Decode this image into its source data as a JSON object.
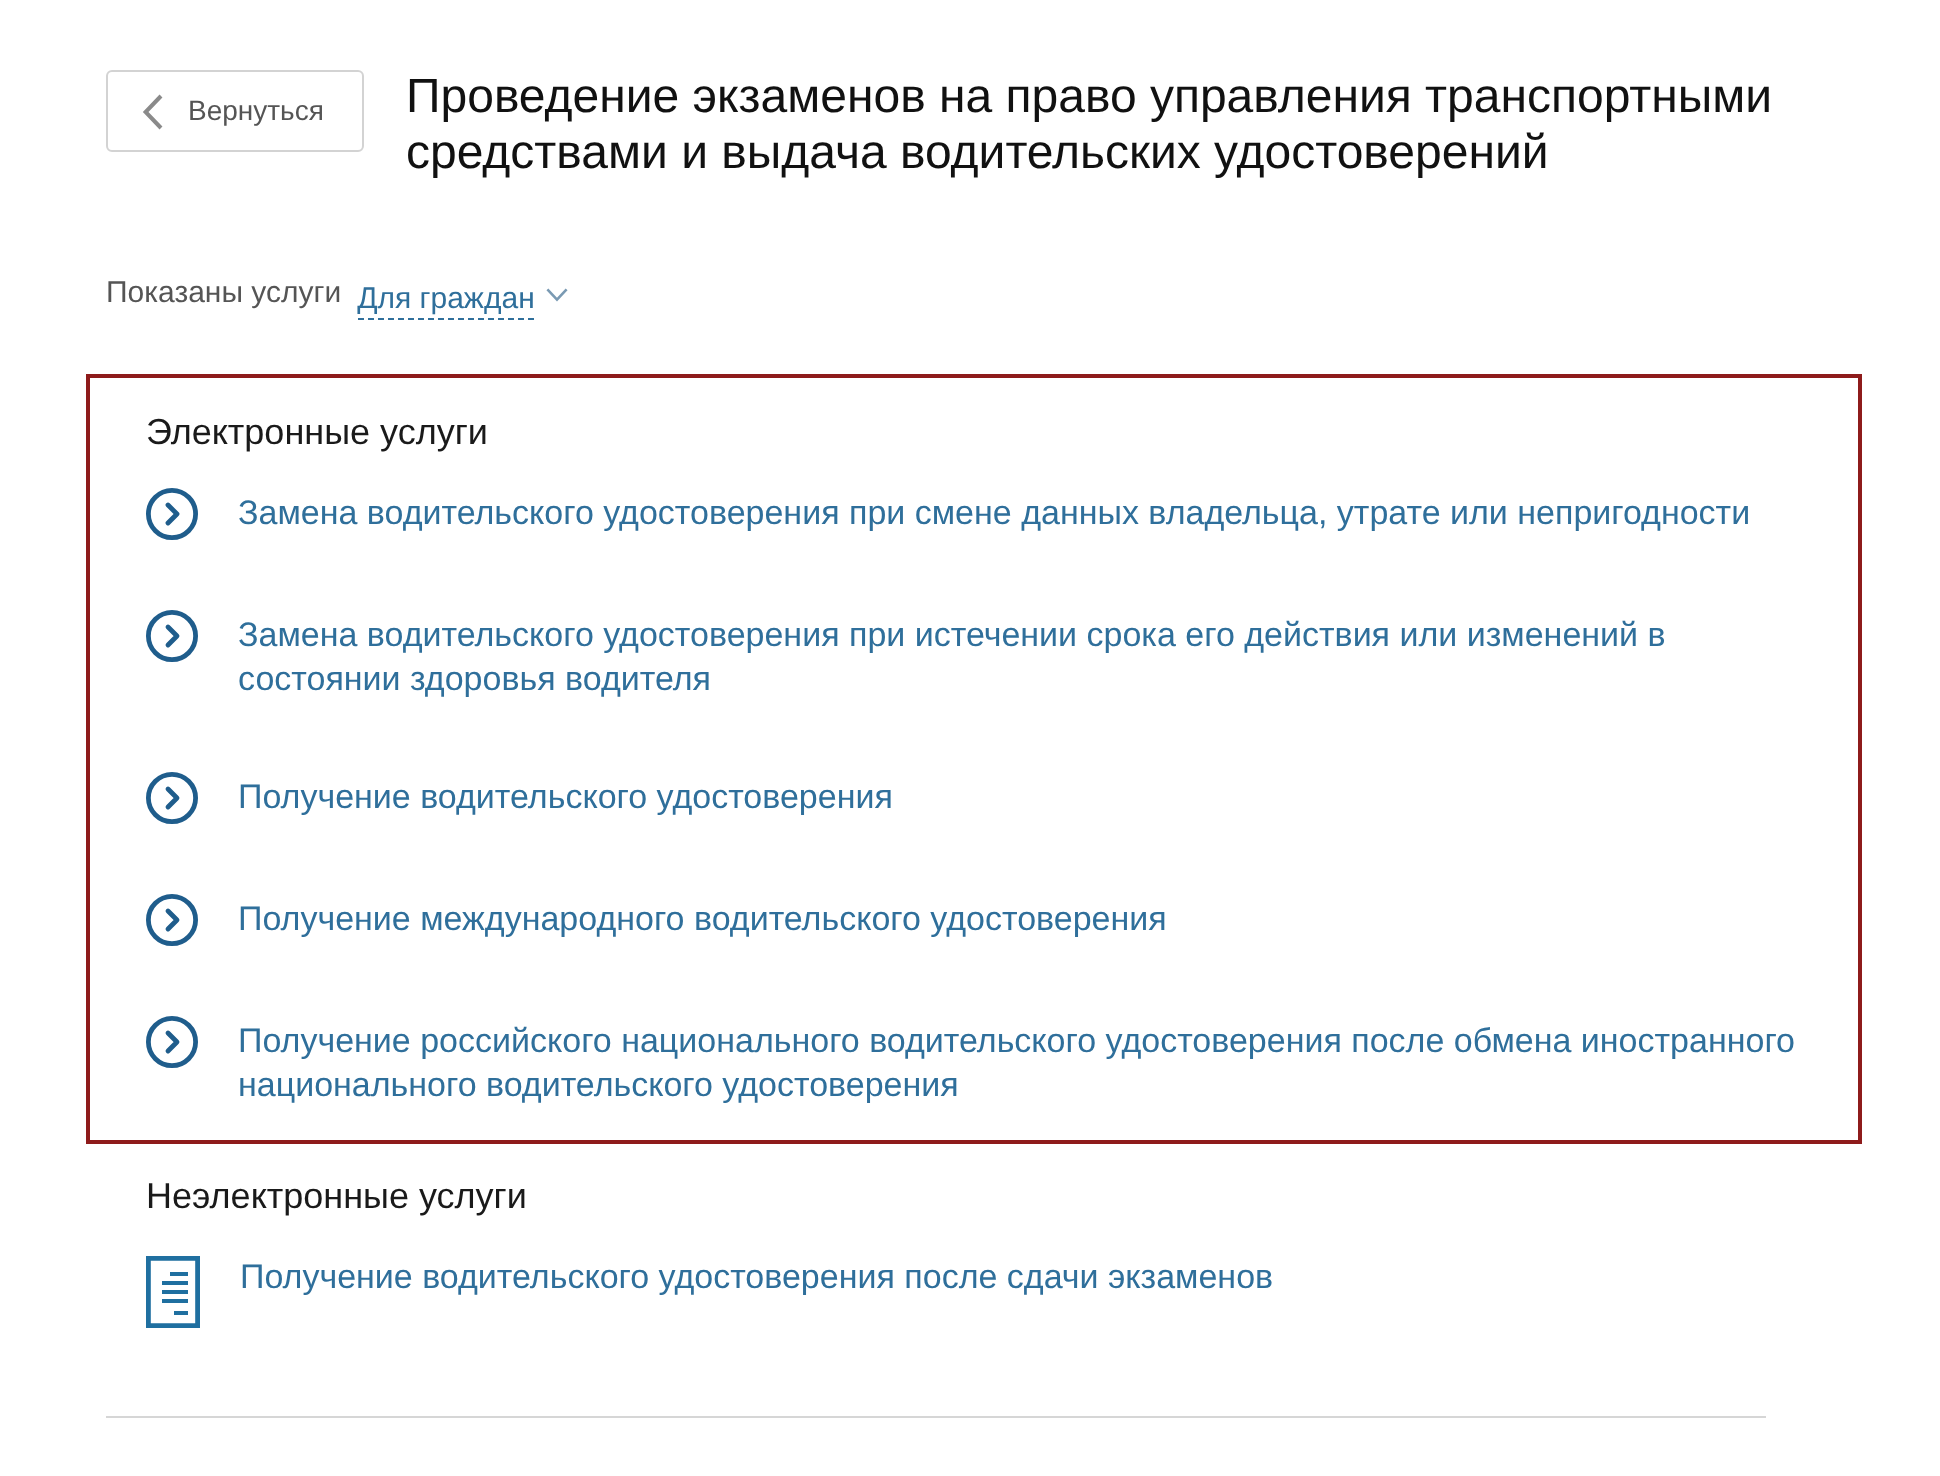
{
  "back_button": {
    "label": "Вернуться"
  },
  "title": "Проведение экзаменов на право управления транспортными средствами и выдача водительских удостоверений",
  "filter": {
    "label": "Показаны услуги",
    "value": "Для граждан"
  },
  "sections": [
    {
      "kind": "electronic",
      "heading": "Электронные услуги",
      "highlighted": true,
      "services": [
        "Замена водительского удостоверения при смене данных владельца, утрате или непригодности",
        "Замена водительского удостоверения при истечении срока его действия или изменений в состоянии здоровья водителя",
        "Получение водительского удостоверения",
        "Получение международного водительского удостоверения",
        "Получение российского национального водительского удостоверения после обмена иностранного национального водительского удостоверения"
      ]
    },
    {
      "kind": "paper",
      "heading": "Неэлектронные услуги",
      "highlighted": false,
      "services": [
        "Получение водительского удостоверения после сдачи экзаменов"
      ]
    }
  ]
}
